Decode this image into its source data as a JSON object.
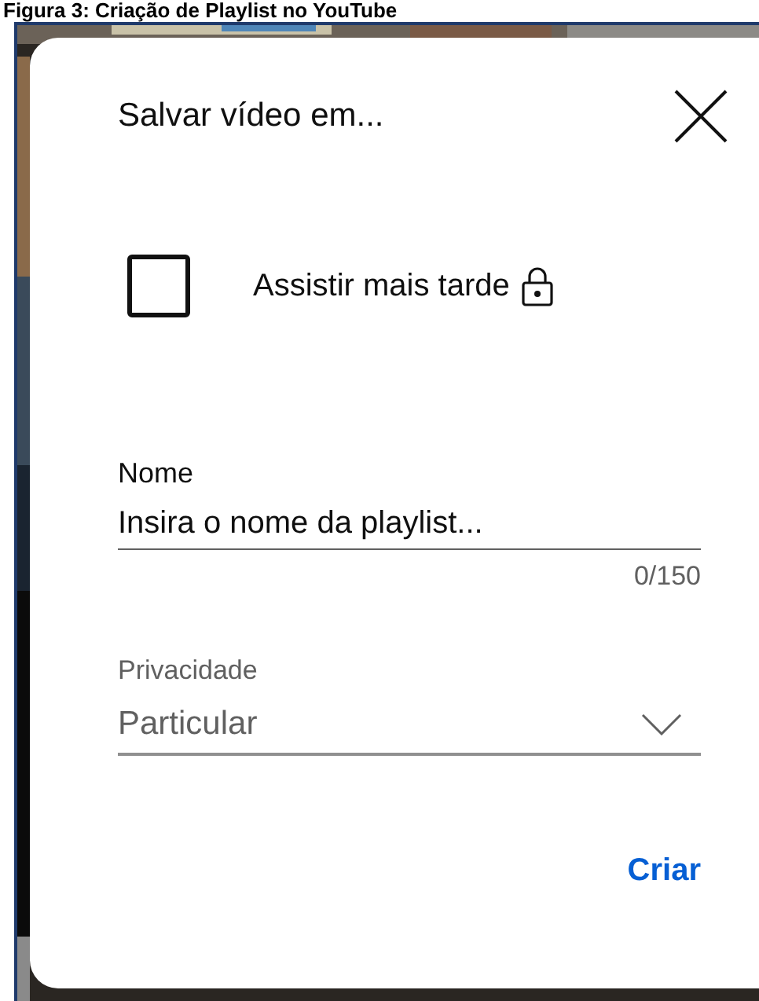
{
  "caption": "Figura 3: Criação de Playlist no YouTube",
  "dialog": {
    "title": "Salvar vídeo em...",
    "playlists": [
      {
        "label": "Assistir mais tarde",
        "checked": false,
        "private": true
      }
    ],
    "name_field": {
      "label": "Nome",
      "placeholder": "Insira o nome da playlist...",
      "counter": "0/150"
    },
    "privacy": {
      "label": "Privacidade",
      "value": "Particular"
    },
    "create_button": "Criar"
  }
}
